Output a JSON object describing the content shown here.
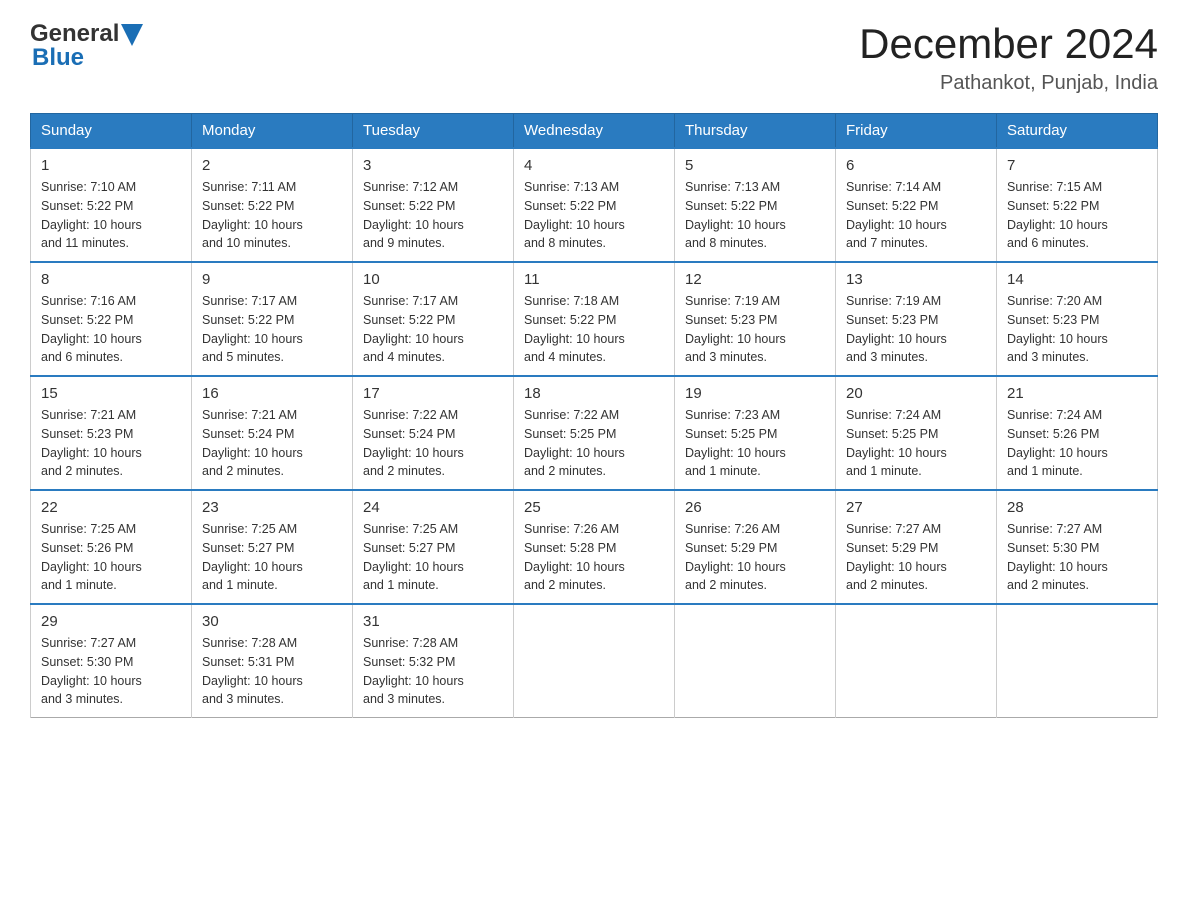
{
  "header": {
    "logo_general": "General",
    "logo_blue": "Blue",
    "month_title": "December 2024",
    "subtitle": "Pathankot, Punjab, India"
  },
  "days_of_week": [
    "Sunday",
    "Monday",
    "Tuesday",
    "Wednesday",
    "Thursday",
    "Friday",
    "Saturday"
  ],
  "weeks": [
    [
      {
        "day": "1",
        "sunrise": "7:10 AM",
        "sunset": "5:22 PM",
        "daylight": "10 hours and 11 minutes."
      },
      {
        "day": "2",
        "sunrise": "7:11 AM",
        "sunset": "5:22 PM",
        "daylight": "10 hours and 10 minutes."
      },
      {
        "day": "3",
        "sunrise": "7:12 AM",
        "sunset": "5:22 PM",
        "daylight": "10 hours and 9 minutes."
      },
      {
        "day": "4",
        "sunrise": "7:13 AM",
        "sunset": "5:22 PM",
        "daylight": "10 hours and 8 minutes."
      },
      {
        "day": "5",
        "sunrise": "7:13 AM",
        "sunset": "5:22 PM",
        "daylight": "10 hours and 8 minutes."
      },
      {
        "day": "6",
        "sunrise": "7:14 AM",
        "sunset": "5:22 PM",
        "daylight": "10 hours and 7 minutes."
      },
      {
        "day": "7",
        "sunrise": "7:15 AM",
        "sunset": "5:22 PM",
        "daylight": "10 hours and 6 minutes."
      }
    ],
    [
      {
        "day": "8",
        "sunrise": "7:16 AM",
        "sunset": "5:22 PM",
        "daylight": "10 hours and 6 minutes."
      },
      {
        "day": "9",
        "sunrise": "7:17 AM",
        "sunset": "5:22 PM",
        "daylight": "10 hours and 5 minutes."
      },
      {
        "day": "10",
        "sunrise": "7:17 AM",
        "sunset": "5:22 PM",
        "daylight": "10 hours and 4 minutes."
      },
      {
        "day": "11",
        "sunrise": "7:18 AM",
        "sunset": "5:22 PM",
        "daylight": "10 hours and 4 minutes."
      },
      {
        "day": "12",
        "sunrise": "7:19 AM",
        "sunset": "5:23 PM",
        "daylight": "10 hours and 3 minutes."
      },
      {
        "day": "13",
        "sunrise": "7:19 AM",
        "sunset": "5:23 PM",
        "daylight": "10 hours and 3 minutes."
      },
      {
        "day": "14",
        "sunrise": "7:20 AM",
        "sunset": "5:23 PM",
        "daylight": "10 hours and 3 minutes."
      }
    ],
    [
      {
        "day": "15",
        "sunrise": "7:21 AM",
        "sunset": "5:23 PM",
        "daylight": "10 hours and 2 minutes."
      },
      {
        "day": "16",
        "sunrise": "7:21 AM",
        "sunset": "5:24 PM",
        "daylight": "10 hours and 2 minutes."
      },
      {
        "day": "17",
        "sunrise": "7:22 AM",
        "sunset": "5:24 PM",
        "daylight": "10 hours and 2 minutes."
      },
      {
        "day": "18",
        "sunrise": "7:22 AM",
        "sunset": "5:25 PM",
        "daylight": "10 hours and 2 minutes."
      },
      {
        "day": "19",
        "sunrise": "7:23 AM",
        "sunset": "5:25 PM",
        "daylight": "10 hours and 1 minute."
      },
      {
        "day": "20",
        "sunrise": "7:24 AM",
        "sunset": "5:25 PM",
        "daylight": "10 hours and 1 minute."
      },
      {
        "day": "21",
        "sunrise": "7:24 AM",
        "sunset": "5:26 PM",
        "daylight": "10 hours and 1 minute."
      }
    ],
    [
      {
        "day": "22",
        "sunrise": "7:25 AM",
        "sunset": "5:26 PM",
        "daylight": "10 hours and 1 minute."
      },
      {
        "day": "23",
        "sunrise": "7:25 AM",
        "sunset": "5:27 PM",
        "daylight": "10 hours and 1 minute."
      },
      {
        "day": "24",
        "sunrise": "7:25 AM",
        "sunset": "5:27 PM",
        "daylight": "10 hours and 1 minute."
      },
      {
        "day": "25",
        "sunrise": "7:26 AM",
        "sunset": "5:28 PM",
        "daylight": "10 hours and 2 minutes."
      },
      {
        "day": "26",
        "sunrise": "7:26 AM",
        "sunset": "5:29 PM",
        "daylight": "10 hours and 2 minutes."
      },
      {
        "day": "27",
        "sunrise": "7:27 AM",
        "sunset": "5:29 PM",
        "daylight": "10 hours and 2 minutes."
      },
      {
        "day": "28",
        "sunrise": "7:27 AM",
        "sunset": "5:30 PM",
        "daylight": "10 hours and 2 minutes."
      }
    ],
    [
      {
        "day": "29",
        "sunrise": "7:27 AM",
        "sunset": "5:30 PM",
        "daylight": "10 hours and 3 minutes."
      },
      {
        "day": "30",
        "sunrise": "7:28 AM",
        "sunset": "5:31 PM",
        "daylight": "10 hours and 3 minutes."
      },
      {
        "day": "31",
        "sunrise": "7:28 AM",
        "sunset": "5:32 PM",
        "daylight": "10 hours and 3 minutes."
      },
      null,
      null,
      null,
      null
    ]
  ],
  "labels": {
    "sunrise": "Sunrise: ",
    "sunset": "Sunset: ",
    "daylight": "Daylight: "
  }
}
